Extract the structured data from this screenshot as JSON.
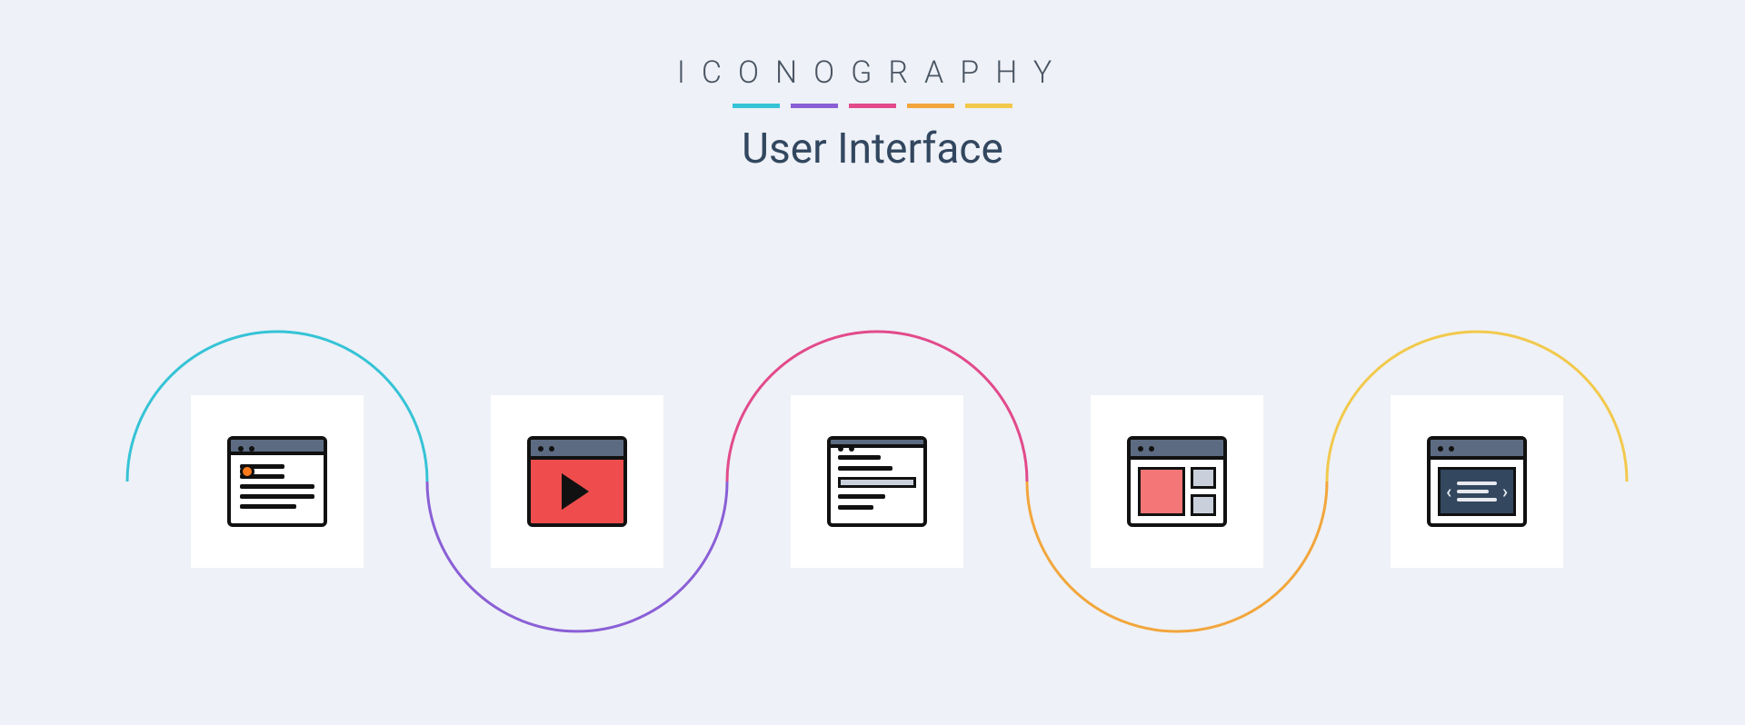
{
  "header": {
    "brand": "ICONOGRAPHY",
    "subtitle": "User Interface",
    "divider_colors": [
      "#35c3d6",
      "#8a5fd6",
      "#e24a8b",
      "#f2a63c",
      "#f2c94c"
    ]
  },
  "wave_colors": [
    "#35c3d6",
    "#8a5fd6",
    "#e24a8b",
    "#f2a63c",
    "#f2c94c"
  ],
  "icons": [
    {
      "name": "article-window-icon"
    },
    {
      "name": "video-window-icon"
    },
    {
      "name": "search-window-icon"
    },
    {
      "name": "layout-sidebar-window-icon"
    },
    {
      "name": "code-window-icon"
    }
  ]
}
